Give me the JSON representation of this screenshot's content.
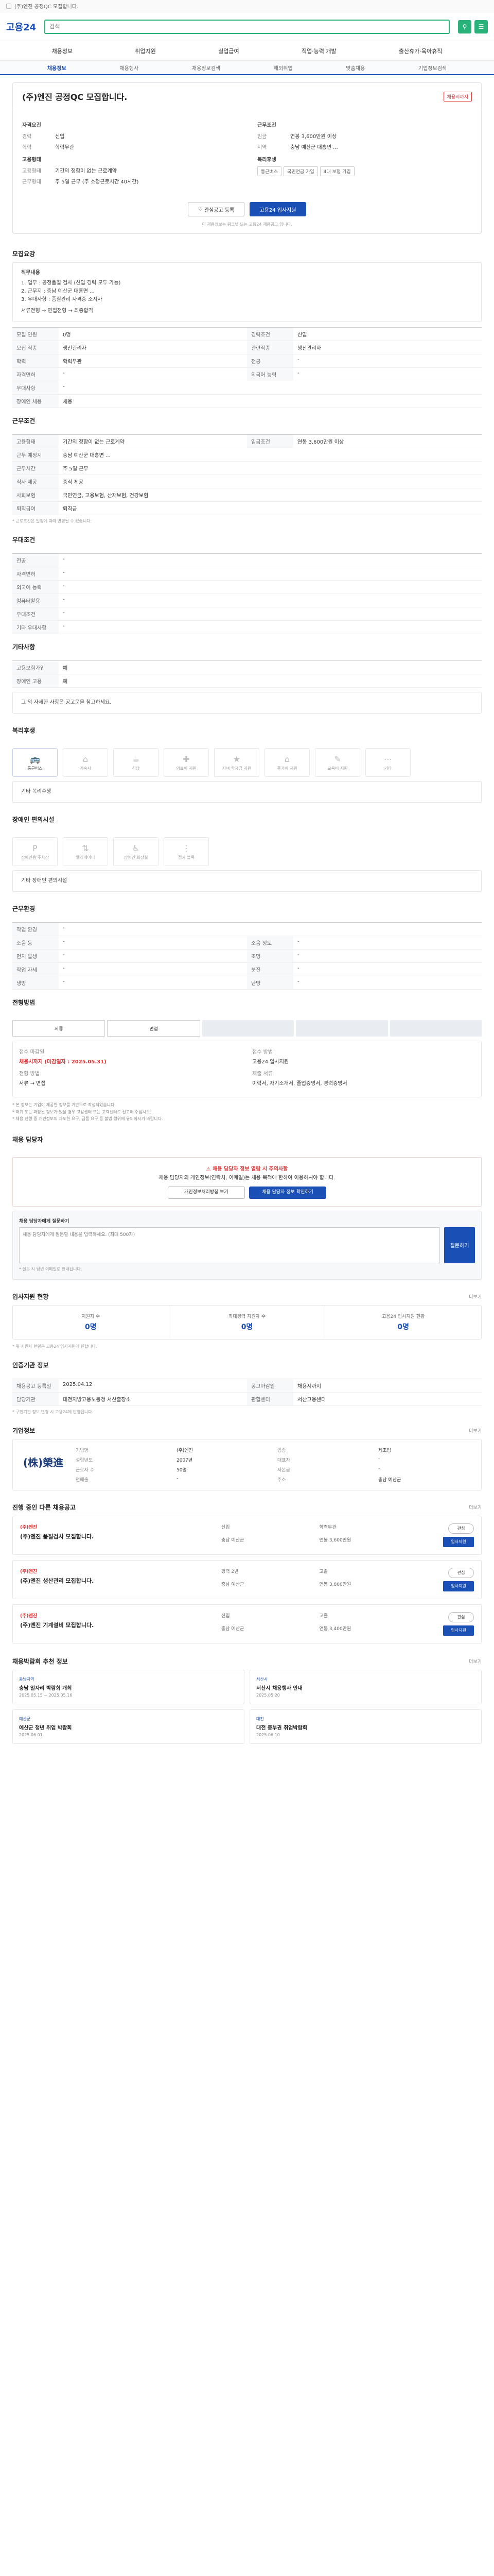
{
  "browser": {
    "title": "(주)엔진 공정QC 모집합니다."
  },
  "header": {
    "logo": "고용24",
    "search_placeholder": "검색"
  },
  "gnb": [
    "채용정보",
    "취업지원",
    "실업급여",
    "직업·능력 개발",
    "출산휴가·육아휴직"
  ],
  "lnb": [
    "채용정보",
    "채용행사",
    "채용정보검색",
    "해외취업",
    "맞춤채용",
    "기업정보검색"
  ],
  "job": {
    "title": "(주)엔진 공정QC 모집합니다.",
    "badge": "채용시까지",
    "left_head": "자격요건",
    "right_head": "근무조건",
    "left": [
      [
        "경력",
        "신입"
      ],
      [
        "학력",
        "학력무관"
      ]
    ],
    "right": [
      [
        "임금",
        "연봉 3,600만원 이상"
      ],
      [
        "지역",
        "충남 예산군 대흥면 ..."
      ]
    ],
    "left2_head": "고용형태",
    "left2": [
      [
        "고용형태",
        "기간의 정함이 없는 근로계약"
      ],
      [
        "근무형태",
        "주 5일 근무 (주 소정근로시간 40시간)"
      ]
    ],
    "right2_head": "복리후생",
    "right2_tags": [
      "통근버스",
      "국민연금 가입",
      "4대 보험 가입"
    ],
    "btn_scrap": "관심공고 등록",
    "btn_apply": "고용24 입사지원",
    "note": "이 채용정보는 워크넷 또는 고용24 채용공고 입니다."
  },
  "recruit": {
    "head": "모집요강",
    "duty_title": "직무내용",
    "duty": "1. 업무 : 공정품질 검사 (신입 경력 모두 가능)\n2. 근무지 : 충남 예산군 대흥면 ...\n3. 우대사항 : 품질관리 자격증 소지자",
    "steps": "서류전형 → 면접전형 → 최종합격"
  },
  "recruit_grid": [
    [
      "모집 인원",
      "0명",
      "경력조건",
      "신입"
    ],
    [
      "모집 직종",
      "생산관리자",
      "관련직종",
      "생산관리자"
    ],
    [
      "학력",
      "학력무관",
      "전공",
      "-"
    ],
    [
      "자격면허",
      "-",
      "외국어 능력",
      "-"
    ],
    [
      "우대사항",
      "-",
      "-",
      "-"
    ],
    [
      "장애인 채용",
      "채용"
    ]
  ],
  "work": {
    "head": "근무조건"
  },
  "work_grid": [
    [
      "고용형태",
      "기간의 정함이 없는 근로계약",
      "임금조건",
      "연봉 3,600만원 이상"
    ],
    [
      "근무 예정지",
      "충남 예산군 대흥면 ..."
    ],
    [
      "근무시간",
      "주 5일 근무"
    ],
    [
      "식사 제공",
      "중식 제공"
    ],
    [
      "사회보험",
      "국민연금, 고용보험, 산재보험, 건강보험"
    ],
    [
      "퇴직급여",
      "퇴직금"
    ]
  ],
  "work_note": "* 근로조건은 일정에 따라 변경될 수 있습니다.",
  "condition_head": "우대조건",
  "condition_grid": [
    [
      "전공",
      "-"
    ],
    [
      "자격면허",
      "-"
    ],
    [
      "외국어 능력",
      "-"
    ],
    [
      "컴퓨터활용",
      "-"
    ],
    [
      "우대조건",
      "-"
    ],
    [
      "기타 우대사항",
      "-"
    ]
  ],
  "etc_head": "기타사항",
  "etc_grid": [
    [
      "고용보험가입",
      "예"
    ],
    [
      "장애인 고용",
      "예"
    ]
  ],
  "etc_more": "그 외 자세한 사항은 공고문을 참고하세요.",
  "welfare": {
    "head": "복리후생",
    "items": [
      "통근버스",
      "기숙사",
      "식당",
      "의료비 지원",
      "자녀 학자금 지원",
      "주거비 지원",
      "교육비 지원",
      "기타"
    ],
    "more": "기타 복리후생"
  },
  "disability": {
    "head": "장애인 편의시설",
    "items": [
      "장애인용 주차장",
      "엘리베이터",
      "장애인 화장실",
      "점자 블록"
    ],
    "more": "기타 장애인 편의시설"
  },
  "workplace": {
    "head": "근무환경",
    "grid": [
      [
        "작업 환경",
        "-"
      ],
      [
        "소음 등",
        "-",
        "소음 정도",
        "-"
      ],
      [
        "먼지 발생",
        "-",
        "조명",
        "-"
      ],
      [
        "작업 자세",
        "-",
        "분진",
        "-"
      ],
      [
        "냉방",
        "-",
        "난방",
        "-"
      ]
    ]
  },
  "apply": {
    "head": "전형방법",
    "steps": [
      "서류",
      "면접",
      "",
      "",
      ""
    ],
    "k1": "접수 마감일",
    "v1": "채용시까지 (마감일자 : 2025.05.31)",
    "k2": "접수 방법",
    "v2": "고용24 입사지원",
    "k3": "전형 방법",
    "v3": "서류 → 면접",
    "k4": "제출 서류",
    "v4": "이력서, 자기소개서, 졸업증명서, 경력증명서"
  },
  "warn": "* 본 정보는 기업이 제공한 정보를 기반으로 작성되었습니다.\n* 허위 또는 과장된 정보가 있을 경우 고용센터 또는 고객센터로 신고해 주십시오.\n* 채용 진행 중 개인정보의 과도한 요구, 금품 요구 등 불법 행위에 유의하시기 바랍니다.",
  "contact": {
    "head": "채용 담당자",
    "red": "채용 담당자 정보 열람 시 주의사항",
    "text": "채용 담당자의 개인정보(연락처, 이메일)는 채용 목적에 한하여 이용하셔야 합니다.",
    "btn1": "개인정보처리방침 보기",
    "btn2": "채용 담당자 정보 확인하기"
  },
  "qa": {
    "label": "채용 담당자에게 질문하기",
    "placeholder": "채용 담당자에게 질문할 내용을 입력하세요. (최대 500자)",
    "send": "질문하기",
    "note": "* 질문 시 답변 이메일로 안내됩니다."
  },
  "stats": {
    "head": "입사지원 현황",
    "more": "더보기",
    "items": [
      [
        "지원자 수",
        "0명"
      ],
      [
        "최대경력 지원자 수",
        "0명"
      ],
      [
        "고용24 입사지원 현황",
        "0명"
      ]
    ],
    "note": "* 위 지원자 현황은 고용24 입사지원에 한합니다."
  },
  "agency": {
    "head": "인증기관 정보",
    "grid": [
      [
        "채용공고 등록일",
        "2025.04.12",
        "공고마감일",
        "채용시까지"
      ],
      [
        "담당기관",
        "대전지방고용노동청 서산출장소",
        "관할센터",
        "서산고용센터"
      ]
    ],
    "note": "* 구인기관 정보 변경 시 고용24에 반영됩니다."
  },
  "company": {
    "head": "기업정보",
    "more": "더보기",
    "logo": "(株)榮進",
    "info": [
      [
        "기업명",
        "(주)엔진"
      ],
      [
        "업종",
        "제조업"
      ],
      [
        "설립년도",
        "2007년"
      ],
      [
        "대표자",
        "-"
      ],
      [
        "근로자 수",
        "50명"
      ],
      [
        "자본금",
        "-"
      ],
      [
        "연매출",
        "-"
      ],
      [
        "주소",
        "충남 예산군"
      ]
    ]
  },
  "jobs": {
    "head": "진행 중인 다른 채용공고",
    "more": "더보기",
    "items": [
      {
        "co": "(주)엔진",
        "t": "(주)엔진 품질검사 모집합니다.",
        "m1": "신입",
        "m2": "학력무관",
        "m3": "충남 예산군",
        "m4": "연봉 3,600만원"
      },
      {
        "co": "(주)엔진",
        "t": "(주)엔진 생산관리 모집합니다.",
        "m1": "경력 2년",
        "m2": "고졸",
        "m3": "충남 예산군",
        "m4": "연봉 3,800만원"
      },
      {
        "co": "(주)엔진",
        "t": "(주)엔진 기계설비 모집합니다.",
        "m1": "신입",
        "m2": "고졸",
        "m3": "충남 예산군",
        "m4": "연봉 3,400만원"
      }
    ],
    "bookmark": "관심",
    "apply": "입사지원"
  },
  "news": {
    "head": "채용박람회 추천 정보",
    "more": "더보기",
    "items": [
      {
        "tag": "충남지역",
        "t": "충남 일자리 박람회 개최",
        "d": "2025.05.15 ~ 2025.05.16"
      },
      {
        "tag": "서산시",
        "t": "서산시 채용행사 안내",
        "d": "2025.05.20"
      },
      {
        "tag": "예산군",
        "t": "예산군 청년 취업 박람회",
        "d": "2025.06.01"
      },
      {
        "tag": "대전",
        "t": "대전 중부권 취업박람회",
        "d": "2025.06.10"
      }
    ]
  }
}
